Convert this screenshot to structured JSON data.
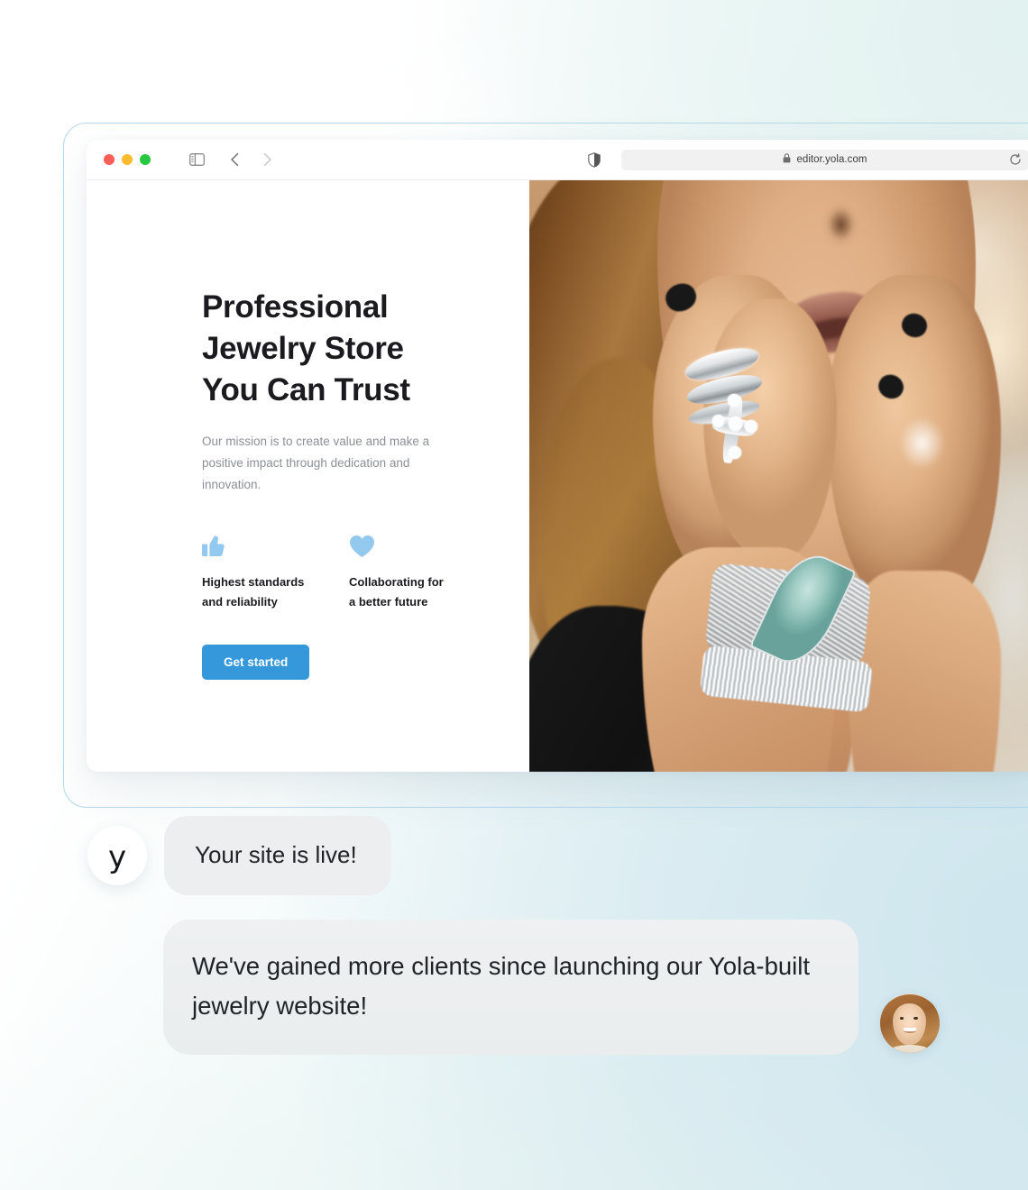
{
  "browser": {
    "traffic_lights": [
      "close",
      "minimize",
      "maximize"
    ],
    "sidebar_icon": "sidebar-toggle-icon",
    "back_icon": "chevron-left-icon",
    "forward_icon": "chevron-right-icon",
    "shield_icon": "shield-privacy-icon",
    "lock_icon": "lock-icon",
    "url": "editor.yola.com",
    "reload_icon": "reload-icon"
  },
  "hero": {
    "title": "Professional\nJewelry Store\nYou Can Trust",
    "subtitle": "Our mission is to create value and make a\npositive impact through dedication and\ninnovation.",
    "features": [
      {
        "icon": "thumbs-up-icon",
        "label": "Highest standards\nand reliability"
      },
      {
        "icon": "heart-icon",
        "label": "Collaborating for\na better future"
      }
    ],
    "cta_label": "Get started",
    "image_alt": "Woman wearing diamond rings and a silver bracelet with a turquoise stone"
  },
  "chat": {
    "messages": [
      {
        "avatar": "yola-logo-avatar",
        "avatar_letter": "y",
        "text": "Your site is live!"
      },
      {
        "avatar": "customer-photo-avatar",
        "text": "We've gained more clients since launching our Yola-built jewelry website!"
      }
    ]
  },
  "colors": {
    "accent_blue": "#3498db",
    "feature_icon_blue": "#93c9ef",
    "bubble_gray": "#eceeef",
    "text_dark": "#1b1b1f",
    "text_muted": "#8b8f94",
    "frame_border": "#b4d8ea",
    "bg_mint": "#e2f2f0",
    "bg_blue": "#cfe6ee"
  }
}
